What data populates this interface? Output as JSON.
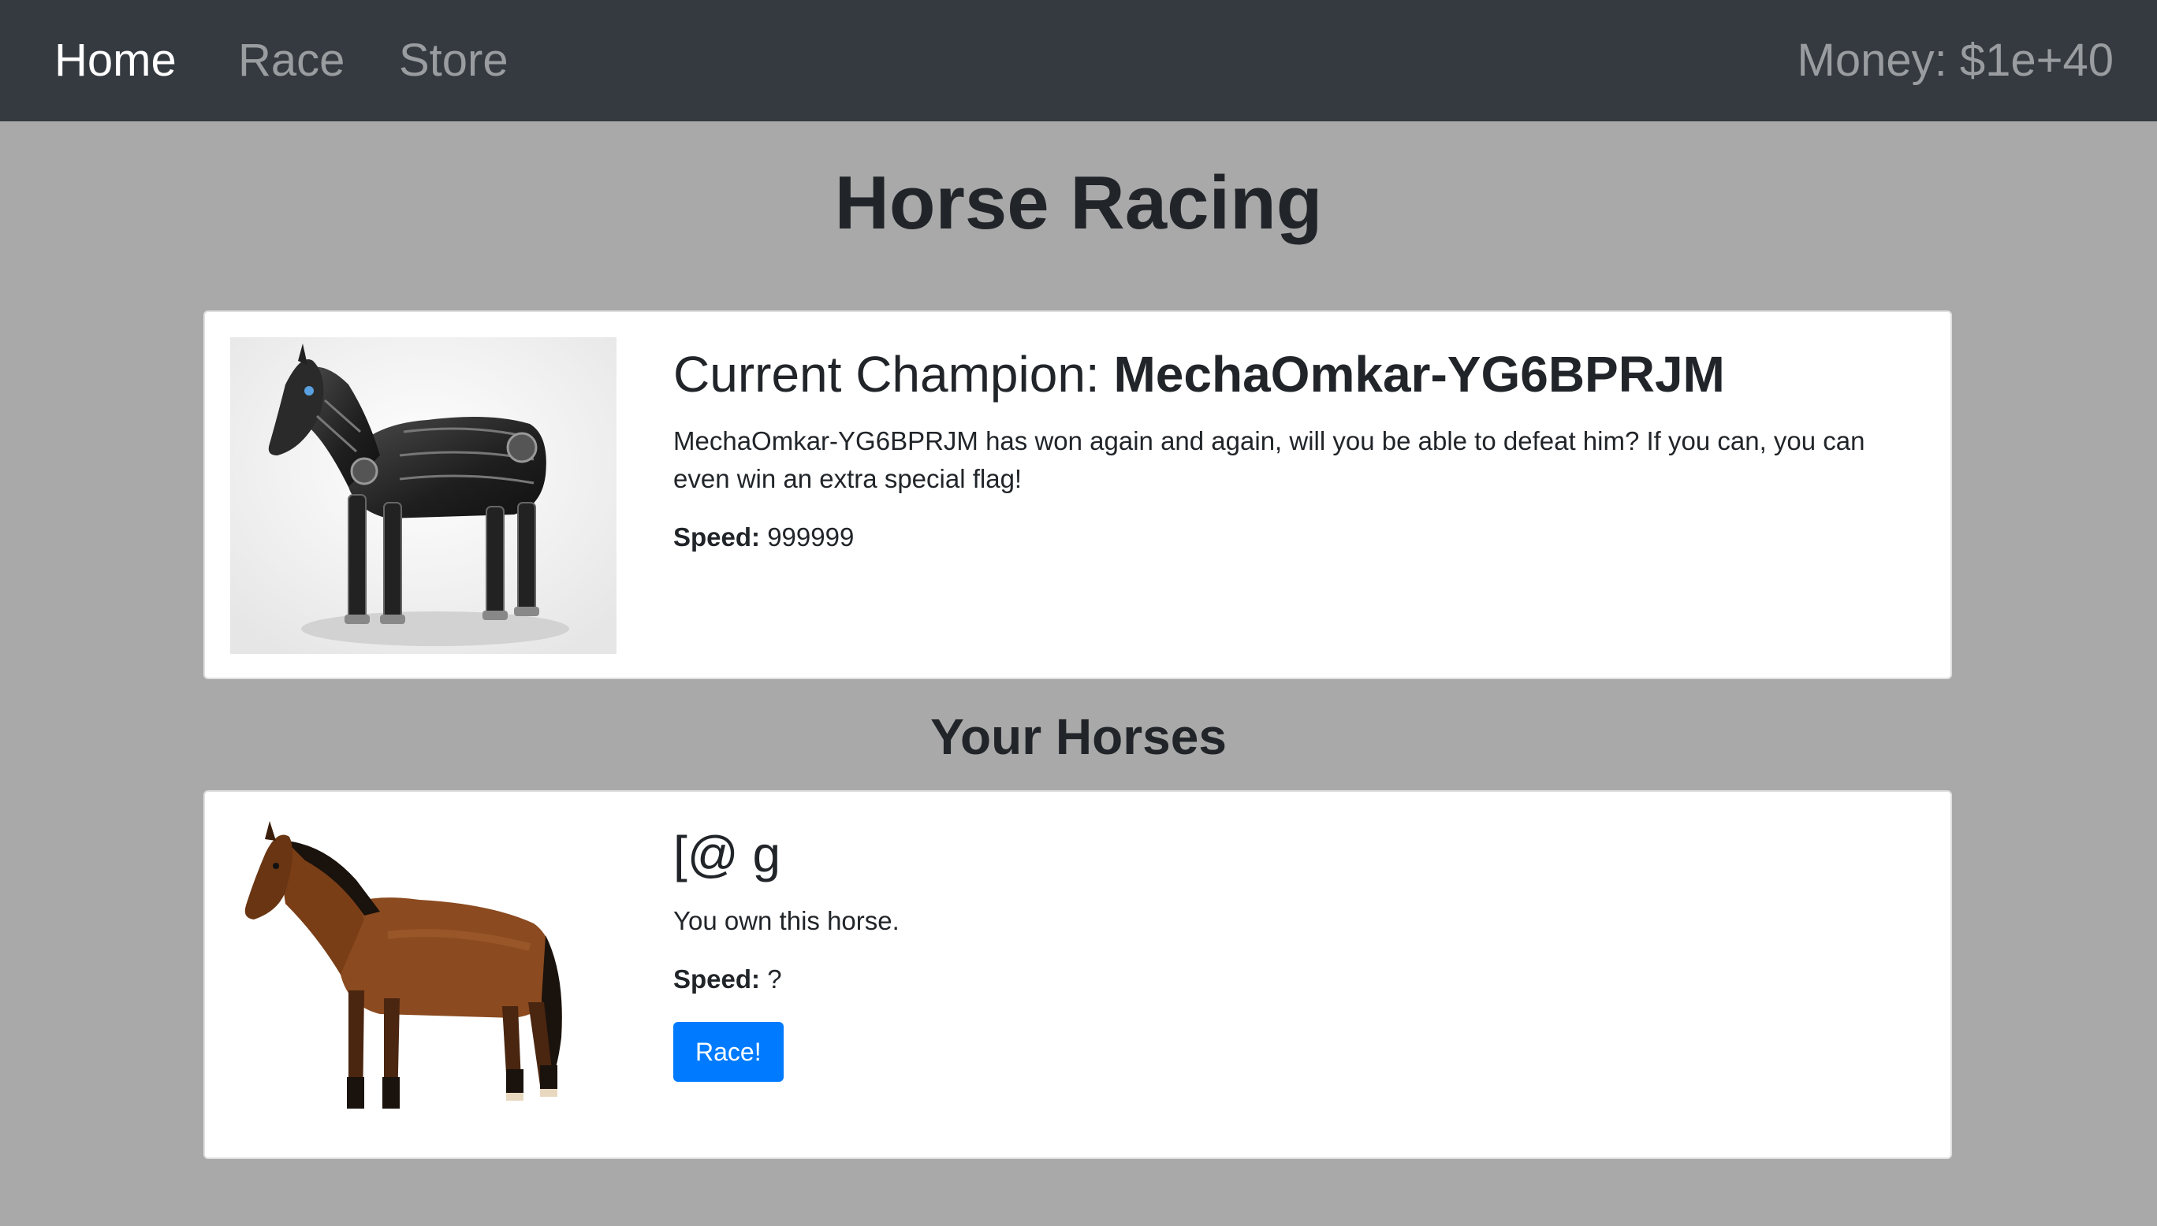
{
  "nav": {
    "home": "Home",
    "race": "Race",
    "store": "Store",
    "money": "Money: $1e+40"
  },
  "page_title": "Horse Racing",
  "champion": {
    "title_prefix": "Current Champion: ",
    "name": "MechaOmkar-YG6BPRJM",
    "description": "MechaOmkar-YG6BPRJM has won again and again, will you be able to defeat him? If you can, you can even win an extra special flag!",
    "speed_label": "Speed:",
    "speed_value": "999999",
    "image_icon": "robot-horse-image"
  },
  "your_horses_title": "Your Horses",
  "horses": [
    {
      "name": "[@ g",
      "description": "You own this horse.",
      "speed_label": "Speed:",
      "speed_value": "?",
      "race_button": "Race!",
      "image_icon": "bay-horse-image"
    }
  ],
  "colors": {
    "navbar": "#343a40",
    "background": "#a9a9a9",
    "primary_button": "#007bff"
  }
}
